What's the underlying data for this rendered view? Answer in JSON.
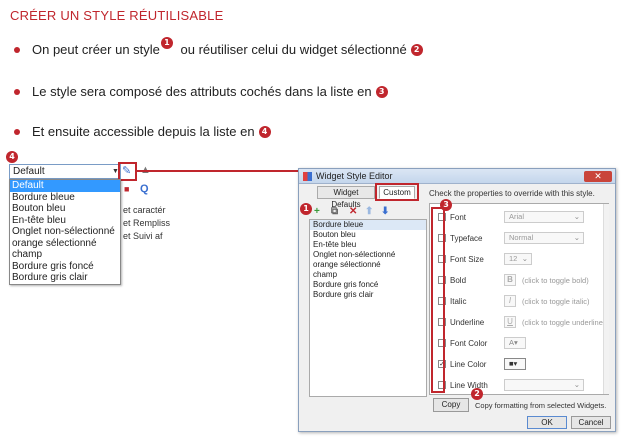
{
  "slide": {
    "title": "CRÉER UN STYLE RÉUTILISABLE",
    "bullets": [
      {
        "pre": "On peut créer un style",
        "badge1": "1",
        "post": " ou réutiliser celui du widget sélectionné",
        "badge2": "2"
      },
      {
        "text": "Le style sera composé des attributs cochés dans la liste en",
        "badge": "3"
      },
      {
        "text": "Et ensuite accessible depuis la liste en",
        "badge": "4"
      }
    ]
  },
  "left_widget": {
    "badge": "4",
    "combo_value": "Default",
    "dropdown_items": [
      "Default",
      "Bordure bleue",
      "Bouton bleu",
      "En-tête bleu",
      "Onglet non-sélectionné",
      "orange sélectionné",
      "champ",
      "Bordure gris foncé",
      "Bordure gris clair"
    ],
    "background_fragments": [
      "et caractér",
      "et Rempliss",
      "et Suivi af"
    ]
  },
  "dialog": {
    "title": "Widget Style Editor",
    "close_label": "✕",
    "tabs": [
      "Widget Defaults",
      "Custom"
    ],
    "instruction": "Check the properties to override with this style.",
    "badge_list": "1",
    "badge_props": "3",
    "badge_copy": "2",
    "style_list": [
      "Bordure bleue",
      "Bouton bleu",
      "En-tête bleu",
      "Onglet non-sélectionné",
      "orange sélectionné",
      "champ",
      "Bordure gris foncé",
      "Bordure gris clair"
    ],
    "properties": [
      {
        "name": "Font",
        "value": "Arial",
        "checked": false
      },
      {
        "name": "Typeface",
        "value": "Normal",
        "checked": false
      },
      {
        "name": "Font Size",
        "value": "12",
        "checked": false
      },
      {
        "name": "Bold",
        "value": "(click to toggle bold)",
        "glyph": "B",
        "checked": false
      },
      {
        "name": "Italic",
        "value": "(click to toggle italic)",
        "glyph": "I",
        "checked": false
      },
      {
        "name": "Underline",
        "value": "(click to toggle underline)",
        "glyph": "U",
        "checked": false
      },
      {
        "name": "Font Color",
        "value": "",
        "checked": false
      },
      {
        "name": "Line Color",
        "value": "",
        "checked": true
      },
      {
        "name": "Line Width",
        "value": "",
        "checked": false
      }
    ],
    "copy_button": "Copy",
    "copy_text": "Copy formatting from selected Widgets.",
    "ok_button": "OK",
    "cancel_button": "Cancel"
  },
  "colors": {
    "accent": "#c0262d",
    "selection": "#3399ff"
  }
}
